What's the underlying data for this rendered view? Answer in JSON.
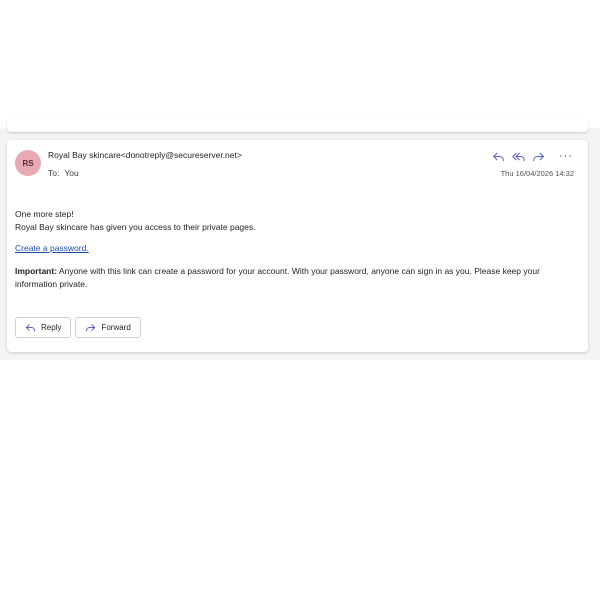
{
  "sender": {
    "initials": "RS",
    "from_line": "Royal Bay skincare<donotreply@secureserver.net>",
    "to_label": "To:",
    "to_value": "You",
    "date": "Thu 16/04/2026 14:32",
    "avatar_color": "#e8a8b4"
  },
  "toolbar": {
    "icons": [
      "reply-icon",
      "reply-all-icon",
      "forward-icon",
      "more-icon"
    ],
    "more_label": "···",
    "accent_color": "#5b5fc7"
  },
  "body": {
    "line1": "One more step!",
    "line2": "Royal Bay skincare has given you access to their private pages.",
    "link": "Create a password.",
    "important_label": "Important:",
    "important_text": " Anyone with this link can create a password for your account. With your password, anyone can sign in as you. Please keep your information private."
  },
  "buttons": {
    "reply": "Reply",
    "forward": "Forward"
  }
}
